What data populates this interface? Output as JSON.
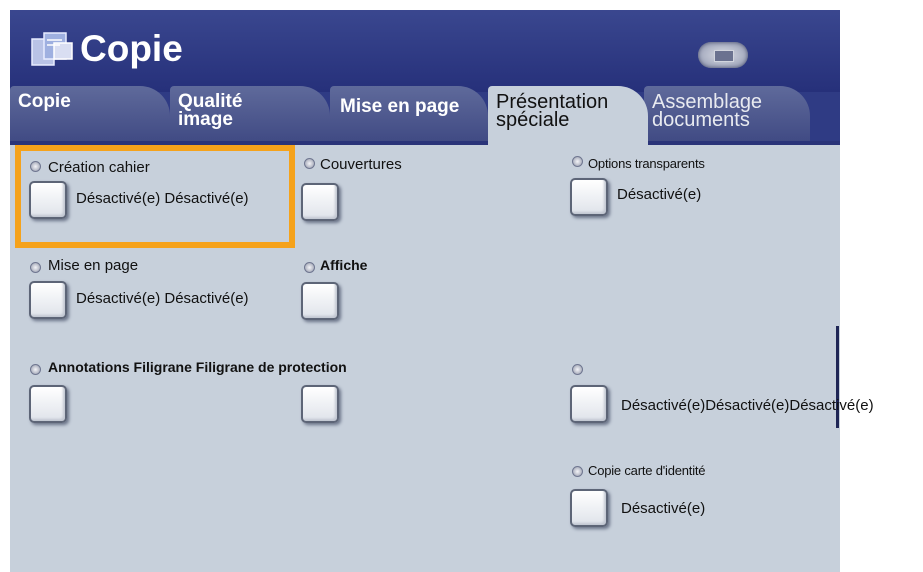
{
  "header": {
    "title": "Copie",
    "app_icon": "copy-icon",
    "status_icon": "machine-status-icon"
  },
  "tabs": [
    {
      "label": "Copie",
      "active": false
    },
    {
      "label": "Qualité\nimage",
      "active": false
    },
    {
      "label": "Mise en page",
      "active": false
    },
    {
      "label": "Présentation\nspéciale",
      "active": true
    },
    {
      "label": "Assemblage\ndocuments",
      "active": false
    }
  ],
  "options": {
    "creation_cahier": {
      "label": "Création cahier",
      "value": "Désactivé(e) Désactivé(e)"
    },
    "couvertures": {
      "label": "Couvertures"
    },
    "options_transparents": {
      "label": "Options transparents",
      "value": "Désactivé(e)"
    },
    "mise_en_page": {
      "label": "Mise en page",
      "value": "Désactivé(e) Désactivé(e)"
    },
    "affiche": {
      "label": "Affiche"
    },
    "annotations": {
      "label": "Annotations Filigrane Filigrane de protection"
    },
    "unnamed": {
      "value": "Désactivé(e)Désactivé(e)Désactivé(e)"
    },
    "copie_carte": {
      "label": "Copie carte d'identité",
      "value": "Désactivé(e)"
    }
  },
  "colors": {
    "header_bg": "#2f3b84",
    "panel_bg": "#c7d0db",
    "highlight": "#f5a21b"
  }
}
